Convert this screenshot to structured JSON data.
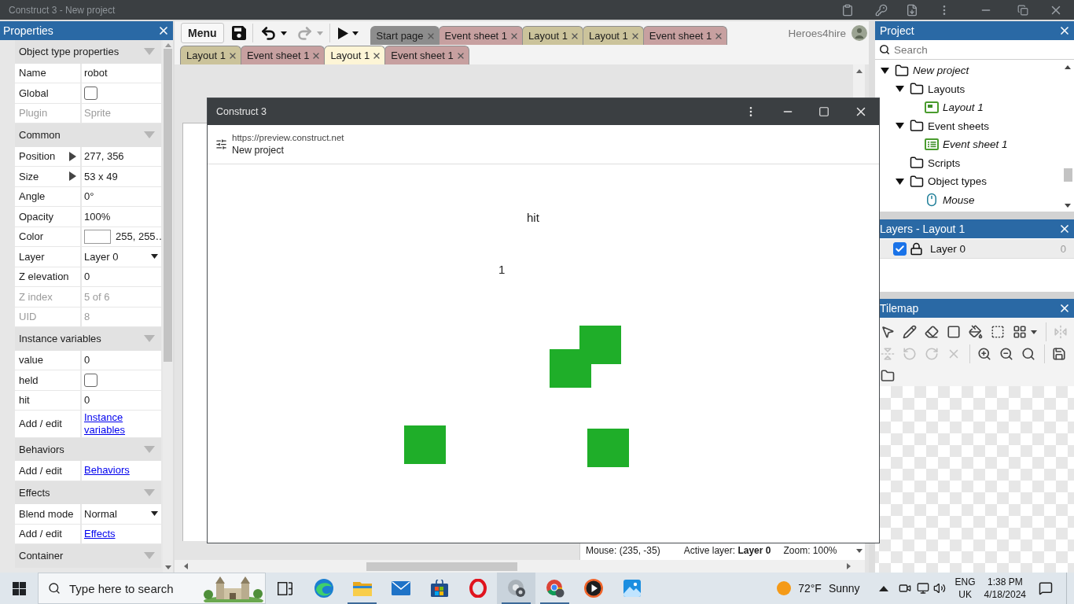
{
  "window": {
    "title": "Construct 3 - New project"
  },
  "properties": {
    "title": "Properties",
    "sections": [
      {
        "title": "Object type properties",
        "expanded": true,
        "rows": [
          {
            "kind": "text",
            "label": "Name",
            "value": "robot",
            "disabled": false
          },
          {
            "kind": "checkbox",
            "label": "Global",
            "checked": false,
            "disabled": false
          },
          {
            "kind": "text",
            "label": "Plugin",
            "value": "Sprite",
            "disabled": true
          }
        ]
      },
      {
        "title": "Common",
        "expanded": true,
        "rows": [
          {
            "kind": "expander",
            "label": "Position",
            "value": "277, 356",
            "expanded": false,
            "disabled": false
          },
          {
            "kind": "expander",
            "label": "Size",
            "value": "53 x 49",
            "expanded": false,
            "disabled": false
          },
          {
            "kind": "text",
            "label": "Angle",
            "value": "0°",
            "disabled": false
          },
          {
            "kind": "text",
            "label": "Opacity",
            "value": "100%",
            "disabled": false
          },
          {
            "kind": "color",
            "label": "Color",
            "value": "255, 255…",
            "disabled": false
          },
          {
            "kind": "select",
            "label": "Layer",
            "value": "Layer 0",
            "disabled": false
          },
          {
            "kind": "text",
            "label": "Z elevation",
            "value": "0",
            "disabled": false
          },
          {
            "kind": "text",
            "label": "Z index",
            "value": "5 of 6",
            "disabled": true
          },
          {
            "kind": "text",
            "label": "UID",
            "value": "8",
            "disabled": true
          }
        ]
      },
      {
        "title": "Instance variables",
        "expanded": true,
        "rows": [
          {
            "kind": "text",
            "label": "value",
            "value": "0",
            "disabled": false
          },
          {
            "kind": "checkbox",
            "label": "held",
            "checked": false,
            "disabled": false
          },
          {
            "kind": "text",
            "label": "hit",
            "value": "0",
            "disabled": false
          },
          {
            "kind": "link",
            "label": "Add / edit",
            "value": "Instance variables",
            "disabled": false
          }
        ]
      },
      {
        "title": "Behaviors",
        "expanded": true,
        "rows": [
          {
            "kind": "link",
            "label": "Add / edit",
            "value": "Behaviors",
            "disabled": false
          }
        ]
      },
      {
        "title": "Effects",
        "expanded": true,
        "rows": [
          {
            "kind": "select",
            "label": "Blend mode",
            "value": "Normal",
            "disabled": false
          },
          {
            "kind": "link",
            "label": "Add / edit",
            "value": "Effects",
            "disabled": false
          }
        ]
      },
      {
        "title": "Container",
        "expanded": true
      }
    ]
  },
  "toolbar": {
    "menu": "Menu",
    "tool_groups": [
      [
        {
          "kind": "save",
          "disabled": false,
          "dropdown": false
        }
      ],
      [
        {
          "kind": "undo",
          "disabled": false,
          "dropdown": true
        },
        {
          "kind": "redo",
          "disabled": true,
          "dropdown": true
        }
      ],
      [
        {
          "kind": "play",
          "disabled": false,
          "dropdown": true
        }
      ]
    ]
  },
  "tab_rows": [
    [
      {
        "label": "Start page",
        "kind": "start_page",
        "selected": false
      },
      {
        "label": "Event sheet 1",
        "kind": "event_sheet",
        "selected": false
      },
      {
        "label": "Layout 1",
        "kind": "layout",
        "selected": false
      },
      {
        "label": "Layout 1",
        "kind": "layout",
        "selected": false
      },
      {
        "label": "Event sheet 1",
        "kind": "event_sheet",
        "selected": false
      }
    ],
    [
      {
        "label": "Layout 1",
        "kind": "layout",
        "selected": false
      },
      {
        "label": "Event sheet 1",
        "kind": "event_sheet",
        "selected": false
      },
      {
        "label": "Layout 1",
        "kind": "layout",
        "selected": true
      },
      {
        "label": "Event sheet 1",
        "kind": "event_sheet",
        "selected": false
      }
    ]
  ],
  "account": {
    "name": "Heroes4hire"
  },
  "status_bar": {
    "mouse": "Mouse: (235, -35)",
    "active_layer": "Active layer: **Layer 0**",
    "zoom": "Zoom: 100%"
  },
  "preview_window": {
    "title": "Construct 3",
    "url": "https://preview.construct.net",
    "page_title": "New project",
    "game_texts": [
      "hit",
      "1"
    ]
  },
  "project": {
    "title": "Project",
    "search_placeholder": "Search",
    "tree": [
      {
        "label": "New project",
        "kind": "project",
        "expanded": true,
        "children": [
          {
            "label": "Layouts",
            "kind": "folder",
            "expanded": true,
            "children": [
              {
                "label": "Layout 1",
                "kind": "layout"
              }
            ]
          },
          {
            "label": "Event sheets",
            "kind": "folder",
            "expanded": true,
            "children": [
              {
                "label": "Event sheet 1",
                "kind": "event_sheet"
              }
            ]
          },
          {
            "label": "Scripts",
            "kind": "folder"
          },
          {
            "label": "Object types",
            "kind": "folder",
            "expanded": true,
            "children": [
              {
                "label": "Mouse",
                "kind": "mouse"
              }
            ]
          }
        ]
      }
    ]
  },
  "layers": {
    "title": "Layers - Layout 1",
    "items": [
      {
        "name": "Layer 0",
        "visible": true,
        "count": "0"
      }
    ]
  },
  "tilemap": {
    "title": "Tilemap",
    "tool_rows": [
      [
        [
          {
            "kind": "pointer",
            "disabled": false
          },
          {
            "kind": "pencil",
            "disabled": false
          },
          {
            "kind": "eraser",
            "disabled": false
          },
          {
            "kind": "rectangle",
            "disabled": false
          },
          {
            "kind": "fill",
            "disabled": false
          },
          {
            "kind": "selection",
            "disabled": false
          },
          {
            "kind": "tiles",
            "disabled": false
          }
        ],
        [
          {
            "kind": "mirror",
            "disabled": true
          }
        ]
      ],
      [
        [
          {
            "kind": "flip",
            "disabled": true
          },
          {
            "kind": "rotate_left",
            "disabled": true
          },
          {
            "kind": "rotate_right",
            "disabled": true
          },
          {
            "kind": "clear",
            "disabled": true
          }
        ],
        [
          {
            "kind": "zoom_in",
            "disabled": false
          },
          {
            "kind": "zoom_out",
            "disabled": false
          },
          {
            "kind": "zoom_reset",
            "disabled": false
          }
        ],
        [
          {
            "kind": "save",
            "disabled": false
          }
        ]
      ],
      [
        [
          {
            "kind": "open",
            "disabled": false
          }
        ]
      ]
    ]
  },
  "taskbar": {
    "search_placeholder": "Type here to search",
    "apps": [
      {
        "kind": "swirl",
        "running": false,
        "active": false
      },
      {
        "kind": "folder",
        "running": true,
        "active": false
      },
      {
        "kind": "mail",
        "running": false,
        "active": false
      },
      {
        "kind": "bag",
        "running": false,
        "active": false
      },
      {
        "kind": "ring",
        "running": false,
        "active": false
      },
      {
        "kind": "disc",
        "running": true,
        "active": true
      },
      {
        "kind": "wheel",
        "running": true,
        "active": false
      },
      {
        "kind": "play",
        "running": false,
        "active": false
      },
      {
        "kind": "picture",
        "running": false,
        "active": false
      }
    ],
    "weather": {
      "temperature": "72°F",
      "condition": "Sunny"
    },
    "language": {
      "code": "ENG",
      "region": "UK"
    },
    "clock": {
      "time": "1:38 PM",
      "date": "4/18/2024"
    }
  }
}
